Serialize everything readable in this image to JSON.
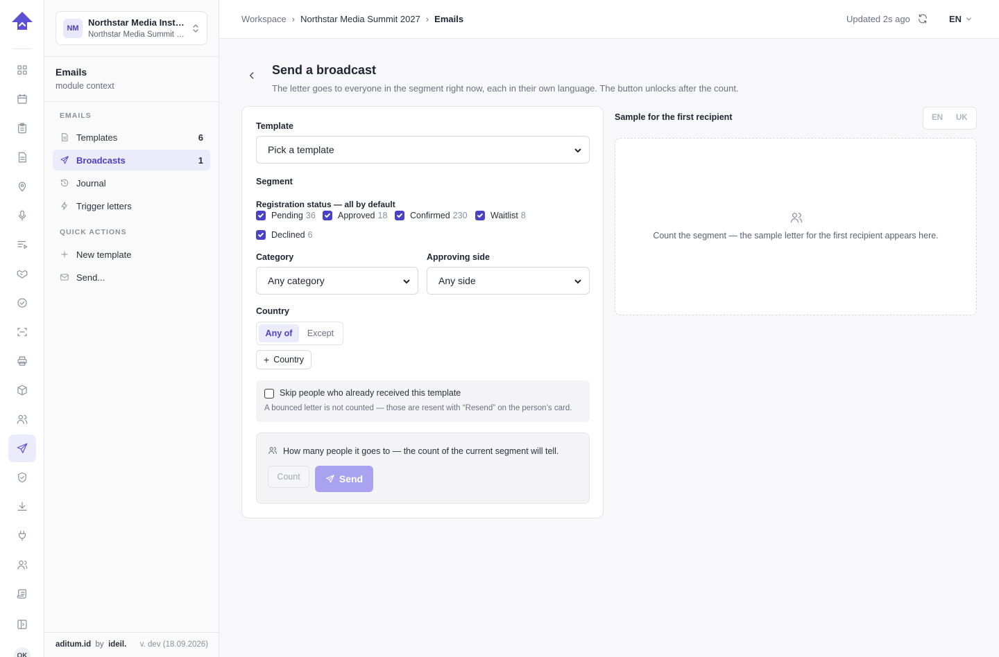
{
  "org": {
    "initials": "NM",
    "name": "Northstar Media Institute",
    "event": "Northstar Media Summit 2027"
  },
  "module": {
    "title": "Emails",
    "subtitle": "module context"
  },
  "sidebar": {
    "section_emails": "EMAILS",
    "items": [
      {
        "label": "Templates",
        "count": "6",
        "icon": "document-icon"
      },
      {
        "label": "Broadcasts",
        "count": "1",
        "icon": "send-icon",
        "active": true
      },
      {
        "label": "Journal",
        "icon": "history-icon"
      },
      {
        "label": "Trigger letters",
        "icon": "bolt-icon"
      }
    ],
    "section_quick": "QUICK ACTIONS",
    "quick": [
      {
        "label": "New template",
        "icon": "plus-icon"
      },
      {
        "label": "Send...",
        "icon": "mail-icon"
      }
    ]
  },
  "footer": {
    "brand": "aditum.id",
    "by": "by",
    "maker": "ideil.",
    "version": "v. dev (18.09.2026)"
  },
  "rail": {
    "avatar_initials": "OK"
  },
  "breadcrumb": {
    "root": "Workspace",
    "event": "Northstar Media Summit 2027",
    "current": "Emails",
    "sep": "›"
  },
  "topbar": {
    "updated": "Updated 2s ago",
    "lang": "EN"
  },
  "page": {
    "title": "Send a broadcast",
    "subtitle": "The letter goes to everyone in the segment right now, each in their own language. The button unlocks after the count."
  },
  "form": {
    "template_label": "Template",
    "template_value": "Pick a template",
    "segment_label": "Segment",
    "status_label": "Registration status — all by default",
    "statuses": [
      {
        "label": "Pending",
        "count": "36",
        "checked": true
      },
      {
        "label": "Approved",
        "count": "18",
        "checked": true
      },
      {
        "label": "Confirmed",
        "count": "230",
        "checked": true
      },
      {
        "label": "Waitlist",
        "count": "8",
        "checked": true
      },
      {
        "label": "Declined",
        "count": "6",
        "checked": true
      }
    ],
    "category_label": "Category",
    "category_value": "Any category",
    "approving_label": "Approving side",
    "approving_value": "Any side",
    "country_label": "Country",
    "country_mode": [
      "Any of",
      "Except"
    ],
    "add_country": "Country",
    "skip_label": "Skip people who already received this template",
    "skip_note": "A bounced letter is not counted — those are resent with “Resend” on the person’s card.",
    "count_text": "How many people it goes to — the count of the current segment will tell.",
    "count_button": "Count",
    "send_button": "Send"
  },
  "preview": {
    "title": "Sample for the first recipient",
    "langs": [
      "EN",
      "UK"
    ],
    "empty_text": "Count the segment — the sample letter for the first recipient appears here."
  },
  "colors": {
    "accent": "#4b41c4",
    "accent_soft": "#ecebfb",
    "send_disabled": "#a9a2ef"
  }
}
